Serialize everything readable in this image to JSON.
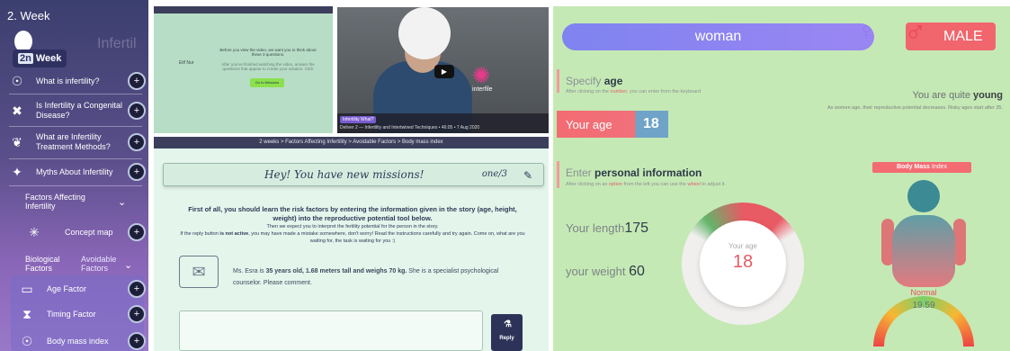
{
  "sidebar": {
    "week_title": "2. Week",
    "bg_word": "Infertil",
    "week_pill_prefix": "2n",
    "week_pill_label": "Week",
    "items": [
      {
        "icon": "☉",
        "label": "What is infertility?"
      },
      {
        "icon": "✖",
        "label": "Is Infertility a Congenital Disease?"
      },
      {
        "icon": "❦",
        "label": "What are Infertility Treatment Methods?"
      },
      {
        "icon": "✦",
        "label": "Myths About Infertility"
      }
    ],
    "factors_section": "Factors Affecting Infertility",
    "concept_map": "Concept map",
    "biological_factors": "Biological Factors",
    "avoidable_factors": "Avoidable Factors",
    "sub_items": [
      {
        "icon": "▭",
        "label": "Age Factor"
      },
      {
        "icon": "⧗",
        "label": "Timing Factor"
      },
      {
        "icon": "☉",
        "label": "Body mass index"
      }
    ]
  },
  "mini_screen": {
    "line1": "Before you view the video, we want you to think about these 3 questions.",
    "line2": "After you've finished watching the video, answer the questions that appear to create your solution. Click",
    "name": "Elif Nur",
    "button": "Go to Missions"
  },
  "video": {
    "logo_text": "interfile",
    "caption_pill": "Infertility What?",
    "caption_text": "Deliver 2 — Infertility and Intertwined Techniques • 46:05 • 7 Aug 2020"
  },
  "missions": {
    "breadcrumb": "2 weeks  >  Factors Affecting Infertility  >  Avoidable Factors  >  Body mass index",
    "title": "Hey! You have new missions!",
    "count": "one/3",
    "para1": "First of all, you should learn the risk factors by entering the information given in the story (age, height, weight) into the reproductive potential tool below.",
    "para2a": "Then we expect you to interpret the fertility potential for the person in the story.",
    "para2b_pre": "If the reply button ",
    "para2b_bold": "is not active",
    "para2b_post": ", you may have made a mistake somewhere, don't worry! Read the instructions carefully and try again. Come on, what are you waiting for, the task is waiting for you :)",
    "story_pre": "Ms. Esra is ",
    "story_bold": "35 years old, 1.68 meters tall and weighs 70 kg.",
    "story_post": " She is a specialist psychological counselor. Please comment.",
    "reply": "Reply"
  },
  "calculator": {
    "woman": "woman",
    "male": "MALE",
    "specify_pre": "Specify ",
    "specify_bold": "age",
    "specify_sub_pre": "After clicking on the ",
    "specify_sub_red": "number",
    "specify_sub_post": ", you can enter from the keyboard",
    "age_label": "Your age",
    "age_value": "18",
    "young_pre": "You are quite ",
    "young_bold": "young",
    "young_sub": "As women age, their reproductive potential decreases. Risky ages start after 35.",
    "info_pre": "Enter ",
    "info_bold": "personal information",
    "info_sub_pre": "After clicking on an ",
    "info_sub_red": "option",
    "info_sub_mid": " from the left you can use the ",
    "info_sub_red2": "wheel",
    "info_sub_post": " to adjust it.",
    "length_label": "Your length",
    "length_value": "175",
    "weight_label": "your weight",
    "weight_value": "60",
    "wheel_label": "Your age",
    "wheel_value": "18",
    "bmi_bold": "Body Mass",
    "bmi_rest": " Index",
    "bmi_status": "Normal",
    "bmi_value": "19.59"
  }
}
